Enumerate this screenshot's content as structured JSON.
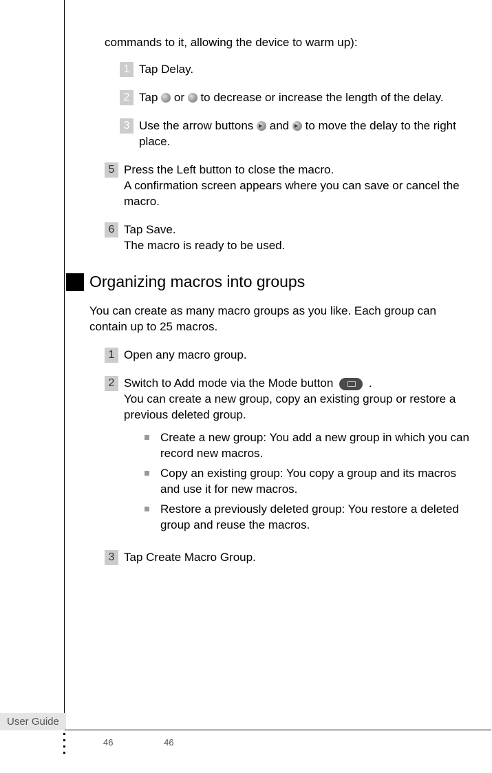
{
  "intro": "commands to it, allowing the device to warm up):",
  "substeps": [
    {
      "num": "1",
      "text_before": "Tap Delay.",
      "text_after": ""
    },
    {
      "num": "2",
      "text_before": "Tap ",
      "text_mid": " or ",
      "text_after": " to decrease or increase the length of the delay."
    },
    {
      "num": "3",
      "text_before": "Use the arrow buttons ",
      "text_mid": " and ",
      "text_after": " to move the delay to the right place."
    }
  ],
  "steps_main": [
    {
      "num": "5",
      "text": "Press the Left button to close the macro.\nA confirmation screen appears where you can save or cancel the macro."
    },
    {
      "num": "6",
      "text": "Tap Save.\nThe macro is ready to be used."
    }
  ],
  "section_title": "Organizing macros into groups",
  "section_intro": "You can create as many macro groups as you like. Each group can contain up to 25 macros.",
  "org_steps": [
    {
      "num": "1",
      "text": "Open any macro group."
    },
    {
      "num": "2",
      "text_before": "Switch to Add mode via the Mode button ",
      "text_after": ".\nYou can create a new group, copy an existing group or restore a previous deleted group."
    },
    {
      "num": "3",
      "text": "Tap Create Macro Group."
    }
  ],
  "bullets": [
    "Create a new group: You add a new group in which you can record new macros.",
    "Copy an existing group: You copy a group and its macros and use it for new macros.",
    "Restore a previously deleted group: You restore a deleted group and reuse the macros."
  ],
  "footer_label": "User Guide",
  "page_number_1": "46",
  "page_number_2": "46"
}
